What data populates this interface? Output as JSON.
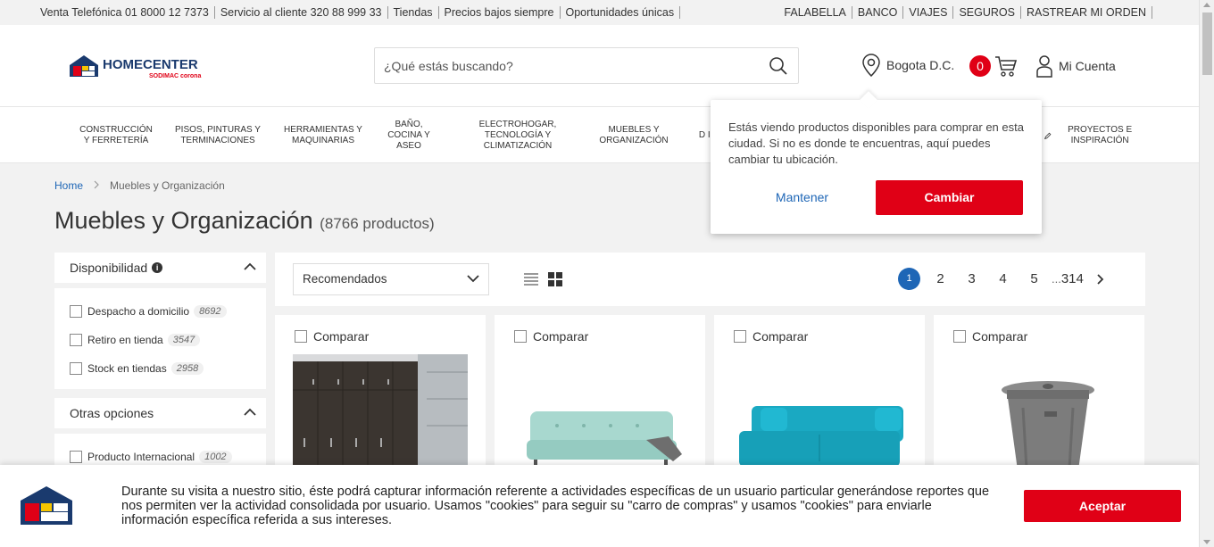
{
  "topbar": {
    "left": [
      "Venta Telefónica 01 8000 12 7373",
      "Servicio al cliente 320 88 999 33",
      "Tiendas",
      "Precios bajos siempre",
      "Oportunidades únicas"
    ],
    "right": [
      "FALABELLA",
      "BANCO",
      "VIAJES",
      "SEGUROS",
      "RASTREAR MI ORDEN"
    ]
  },
  "header": {
    "logo_text": "HOMECENTER",
    "logo_sub": "SODIMAC corona",
    "search_placeholder": "¿Qué estás buscando?",
    "location": "Bogota D.C.",
    "cart_count": "0",
    "account": "Mi Cuenta"
  },
  "categories": [
    "CONSTRUCCIÓN Y FERRETERÍA",
    "PISOS, PINTURAS Y TERMINACIONES",
    "HERRAMIENTAS Y MAQUINARIAS",
    "BAÑO, COCINA Y ASEO",
    "ELECTROHOGAR, TECNOLOGÍA Y CLIMATIZACIÓN",
    "MUEBLES Y ORGANIZACIÓN",
    "D IL",
    "PROYECTOS E INSPIRACIÓN"
  ],
  "breadcrumb": {
    "home": "Home",
    "current": "Muebles y Organización"
  },
  "page": {
    "title": "Muebles y Organización",
    "count": "(8766 productos)"
  },
  "filters": {
    "availability": {
      "title": "Disponibilidad",
      "items": [
        {
          "label": "Despacho a domicilio",
          "count": "8692"
        },
        {
          "label": "Retiro en tienda",
          "count": "3547"
        },
        {
          "label": "Stock en tiendas",
          "count": "2958"
        }
      ]
    },
    "other": {
      "title": "Otras opciones",
      "items": [
        {
          "label": "Producto Internacional",
          "count": "1002"
        }
      ]
    }
  },
  "toolbar": {
    "sort_selected": "Recomendados",
    "pages": [
      "1",
      "2",
      "3",
      "4",
      "5"
    ],
    "ellipsis": "...",
    "last_page": "314"
  },
  "products": [
    {
      "compare": "Comparar",
      "image": "wardrobe-image"
    },
    {
      "compare": "Comparar",
      "image": "mint-sofa-image"
    },
    {
      "compare": "Comparar",
      "image": "turquoise-sofa-image"
    },
    {
      "compare": "Comparar",
      "image": "trash-bin-image"
    }
  ],
  "location_popover": {
    "message": "Estás viendo productos disponibles para comprar en esta ciudad. Si no es donde te encuentras, aquí puedes cambiar tu ubicación.",
    "keep": "Mantener",
    "change": "Cambiar"
  },
  "cookie_banner": {
    "text": "Durante su visita a nuestro sitio, éste podrá capturar información referente a actividades específicas de un usuario particular generándose reportes que nos permiten ver la actividad consolidada por usuario. Usamos \"cookies\" para seguir su \"carro de compras\" y usamos \"cookies\" para enviarle información específica referida a sus intereses.",
    "accept": "Aceptar"
  },
  "colors": {
    "brand_red": "#e00016",
    "brand_blue": "#1e66b6",
    "logo_navy": "#1a3a6e",
    "logo_yellow": "#f6c500"
  }
}
